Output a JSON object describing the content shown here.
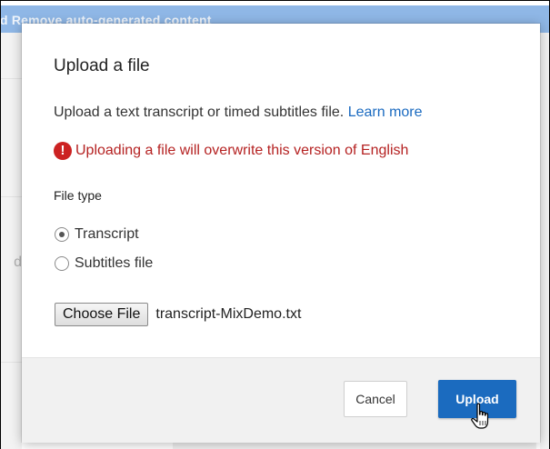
{
  "background": {
    "banner_text": "d  Remove auto-generated content",
    "side_text": "d"
  },
  "dialog": {
    "title": "Upload a file",
    "description": "Upload a text transcript or timed subtitles file.",
    "learn_more_label": "Learn more",
    "warning_icon": "!",
    "warning_text": "Uploading a file will overwrite this version of English",
    "file_type_label": "File type",
    "file_type_options": [
      {
        "label": "Transcript",
        "selected": true
      },
      {
        "label": "Subtitles file",
        "selected": false
      }
    ],
    "choose_file_label": "Choose File",
    "chosen_file_name": "transcript-MixDemo.txt",
    "cancel_label": "Cancel",
    "upload_label": "Upload"
  },
  "colors": {
    "accent": "#1b6bbf",
    "link": "#1a6ac0",
    "warning": "#cc2222"
  },
  "icons": {
    "warning": "exclamation-circle-icon",
    "cursor": "hand-pointer-icon"
  }
}
